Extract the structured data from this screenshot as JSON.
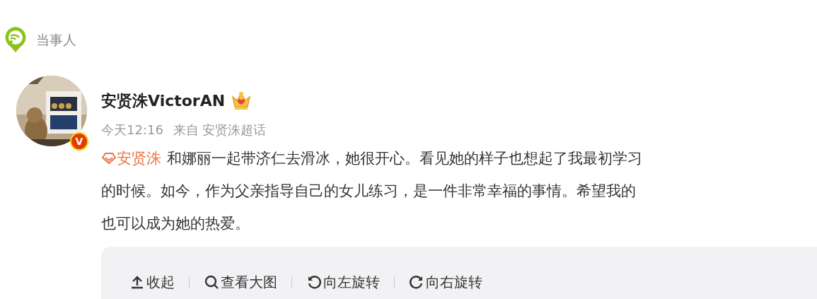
{
  "section_label": "当事人",
  "post": {
    "author": "安贤洙VictorAN",
    "verified_badge": "V",
    "time": "今天12:16",
    "source_prefix": "来自",
    "source": "安贤洙超话",
    "topic": "安贤洙",
    "lines": [
      "和娜丽一起带济仁去滑冰，她很开心。看见她的样子也想起了我最初学习",
      "的时候。如今，作为父亲指导自己的女儿练习，是一件非常幸福的事情。希望我的",
      "也可以成为她的热爱。"
    ]
  },
  "toolbar": [
    {
      "kind": "collapse",
      "label": "收起"
    },
    {
      "kind": "zoom",
      "label": "查看大图"
    },
    {
      "kind": "rotate-left",
      "label": "向左旋转"
    },
    {
      "kind": "rotate-right",
      "label": "向右旋转"
    }
  ]
}
